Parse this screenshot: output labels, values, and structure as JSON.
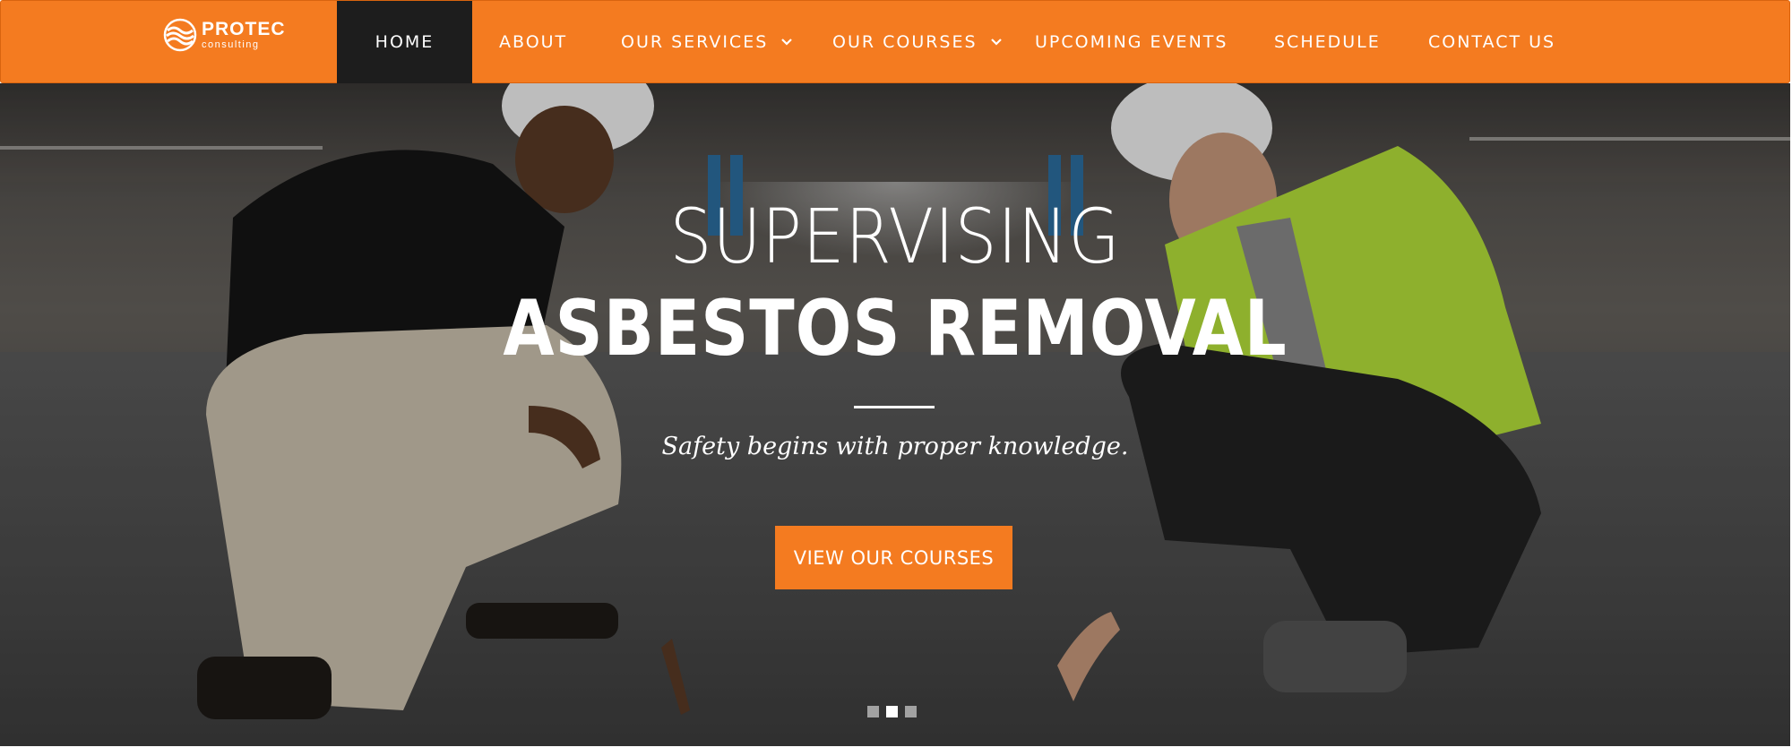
{
  "brand": {
    "name": "PROTEC",
    "tagline": "consulting",
    "accent_color": "#f47b20",
    "active_nav_color": "#1d1d1d"
  },
  "nav": {
    "items": [
      {
        "label": "HOME",
        "active": true,
        "has_dropdown": false
      },
      {
        "label": "ABOUT",
        "active": false,
        "has_dropdown": false
      },
      {
        "label": "OUR SERVICES",
        "active": false,
        "has_dropdown": true
      },
      {
        "label": "OUR COURSES",
        "active": false,
        "has_dropdown": true
      },
      {
        "label": "UPCOMING EVENTS",
        "active": false,
        "has_dropdown": false
      },
      {
        "label": "SCHEDULE",
        "active": false,
        "has_dropdown": false
      },
      {
        "label": "CONTACT US",
        "active": false,
        "has_dropdown": false
      }
    ],
    "dropdown_icon": "chevron-down-icon"
  },
  "hero": {
    "title_light": "SUPERVISING",
    "title_bold": "ASBESTOS REMOVAL",
    "tagline": "Safety begins with proper knowledge.",
    "cta_label": "VIEW OUR COURSES",
    "slides_total": 3,
    "active_slide": 2
  }
}
